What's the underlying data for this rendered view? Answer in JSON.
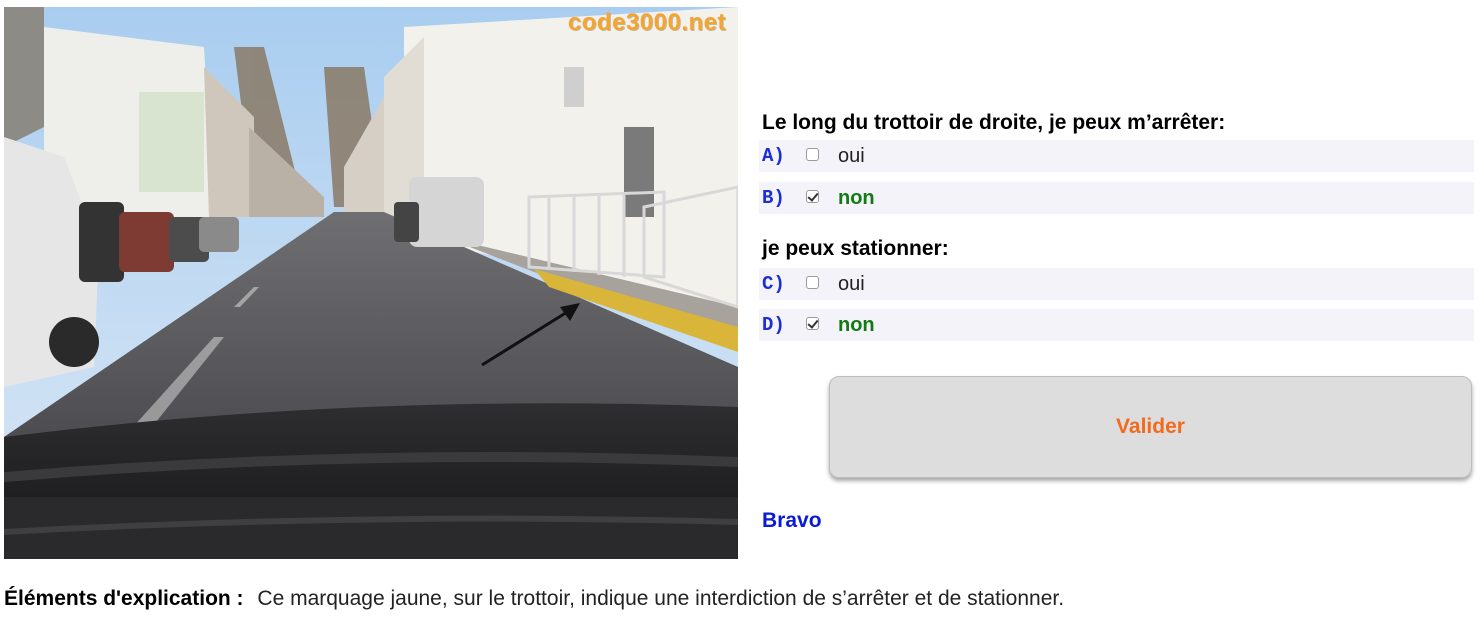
{
  "photo": {
    "watermark": "code3000.net",
    "description_icon": "road-photo"
  },
  "question1": {
    "title": "Le long du trottoir de droite, je peux m’arrêter:",
    "answers": [
      {
        "letter": "A)",
        "text": "oui",
        "checked": false,
        "correct": false
      },
      {
        "letter": "B)",
        "text": "non",
        "checked": true,
        "correct": true
      }
    ]
  },
  "question2": {
    "title": "je peux stationner:",
    "answers": [
      {
        "letter": "C)",
        "text": "oui",
        "checked": false,
        "correct": false
      },
      {
        "letter": "D)",
        "text": "non",
        "checked": true,
        "correct": true
      }
    ]
  },
  "validate_label": "Valider",
  "result": "Bravo",
  "explanation": {
    "label": "Éléments d'explication :",
    "text": "Ce marquage jaune, sur le trottoir, indique une interdiction de s’arrêter et de stationner."
  },
  "colors": {
    "letter": "#1a2fd6",
    "correct": "#137a13",
    "validate_text": "#f26b1d",
    "bravo": "#0a1ad8",
    "watermark": "#f4a531"
  }
}
